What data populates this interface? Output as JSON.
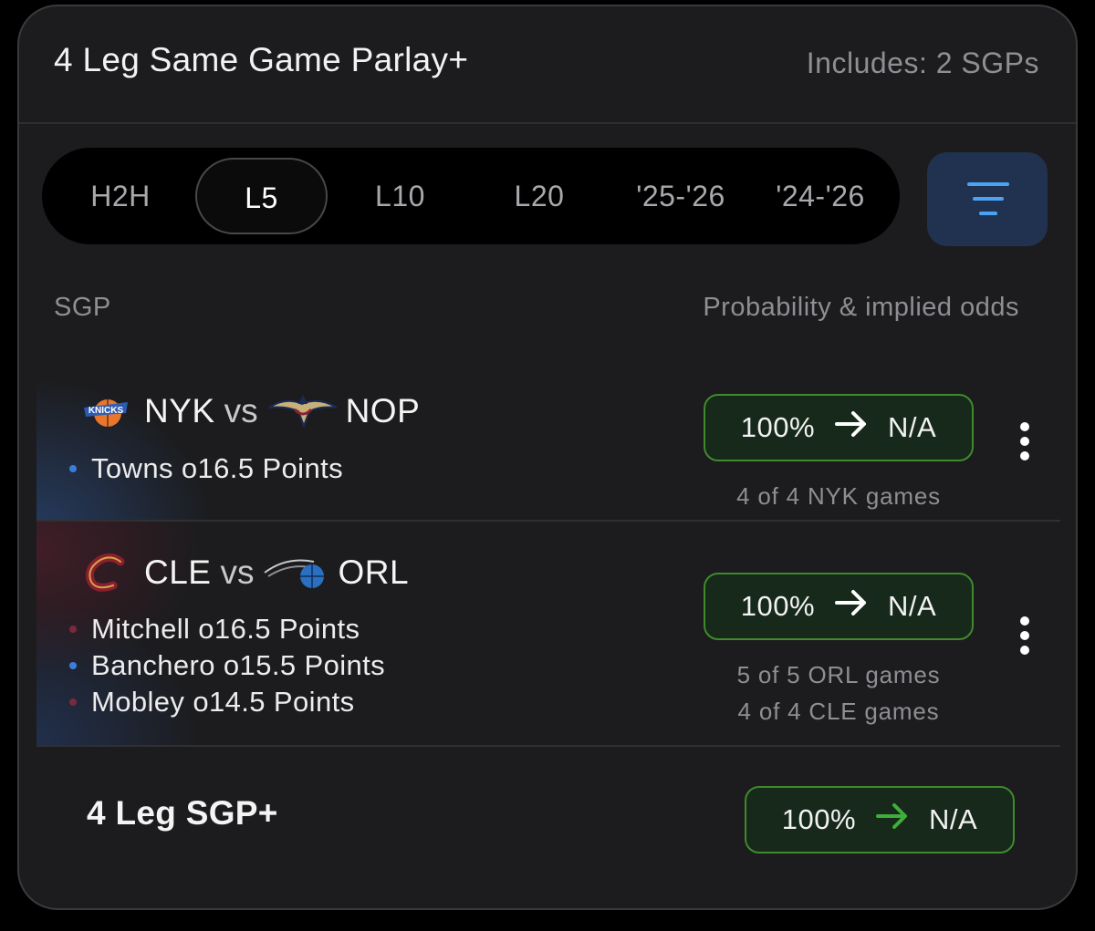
{
  "header": {
    "title": "4 Leg Same Game Parlay+",
    "includes": "Includes: 2 SGPs"
  },
  "filters": {
    "tabs": [
      {
        "label": "H2H",
        "active": false
      },
      {
        "label": "L5",
        "active": true
      },
      {
        "label": "L10",
        "active": false
      },
      {
        "label": "L20",
        "active": false
      },
      {
        "label": "'25-'26",
        "active": false
      },
      {
        "label": "'24-'26",
        "active": false
      }
    ],
    "filter_icon": "filter-lines-icon"
  },
  "columns": {
    "left": "SGP",
    "right": "Probability & implied odds"
  },
  "games": [
    {
      "home": "NYK",
      "vs": "vs",
      "away": "NOP",
      "home_logo": "knicks-logo",
      "away_logo": "pelicans-logo",
      "legs": [
        {
          "text": "Towns o16.5 Points",
          "dot_color": "#3b7ddd"
        }
      ],
      "probability": "100%",
      "odds": "N/A",
      "notes": [
        "4 of 4 NYK games"
      ]
    },
    {
      "home": "CLE",
      "vs": "vs",
      "away": "ORL",
      "home_logo": "cavaliers-logo",
      "away_logo": "magic-logo",
      "legs": [
        {
          "text": "Mitchell o16.5 Points",
          "dot_color": "#7a2a3a"
        },
        {
          "text": "Banchero o15.5 Points",
          "dot_color": "#3b7ddd"
        },
        {
          "text": "Mobley o14.5 Points",
          "dot_color": "#7a2a3a"
        }
      ],
      "probability": "100%",
      "odds": "N/A",
      "notes": [
        "5 of 5 ORL games",
        "4 of 4 CLE games"
      ]
    }
  ],
  "total": {
    "label": "4 Leg SGP+",
    "probability": "100%",
    "odds": "N/A"
  },
  "colors": {
    "accent_green": "#3f8a2c",
    "accent_blue": "#4aa3f5",
    "background": "#1c1c1e"
  }
}
